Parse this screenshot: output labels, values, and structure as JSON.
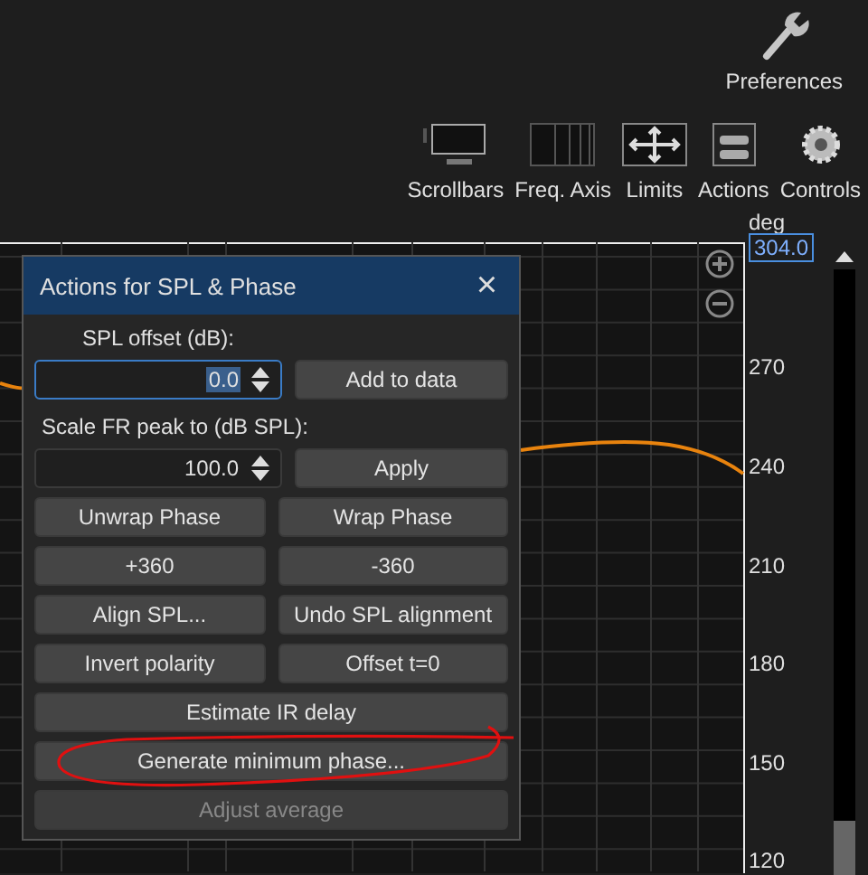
{
  "preferences": {
    "label": "Preferences"
  },
  "toolbar": [
    {
      "label": "Scrollbars",
      "kind": "scrollbars"
    },
    {
      "label": "Freq. Axis",
      "kind": "freq"
    },
    {
      "label": "Limits",
      "kind": "limits"
    },
    {
      "label": "Actions",
      "kind": "actions"
    },
    {
      "label": "Controls",
      "kind": "controls"
    }
  ],
  "axis": {
    "unit": "deg",
    "cursor_value": "304.0",
    "ticks": [
      "270",
      "240",
      "210",
      "180",
      "150",
      "120"
    ]
  },
  "dialog": {
    "title": "Actions for SPL & Phase",
    "close": "×",
    "spl_offset": {
      "label": "SPL offset (dB):",
      "value": "0.0",
      "focused": true,
      "button": "Add to data"
    },
    "scale_peak": {
      "label": "Scale FR peak to (dB SPL):",
      "value": "100.0",
      "focused": false,
      "button": "Apply"
    },
    "button_rows": [
      [
        {
          "label": "Unwrap Phase",
          "disabled": false
        },
        {
          "label": "Wrap Phase",
          "disabled": false
        }
      ],
      [
        {
          "label": "+360",
          "disabled": false
        },
        {
          "label": "-360",
          "disabled": false
        }
      ],
      [
        {
          "label": "Align SPL...",
          "disabled": false
        },
        {
          "label": "Undo SPL alignment",
          "disabled": false
        }
      ],
      [
        {
          "label": "Invert polarity",
          "disabled": false
        },
        {
          "label": "Offset t=0",
          "disabled": false
        }
      ],
      [
        {
          "label": "Estimate IR delay",
          "disabled": false
        }
      ],
      [
        {
          "label": "Generate minimum phase...",
          "disabled": false
        }
      ],
      [
        {
          "label": "Adjust average",
          "disabled": true
        }
      ]
    ]
  }
}
